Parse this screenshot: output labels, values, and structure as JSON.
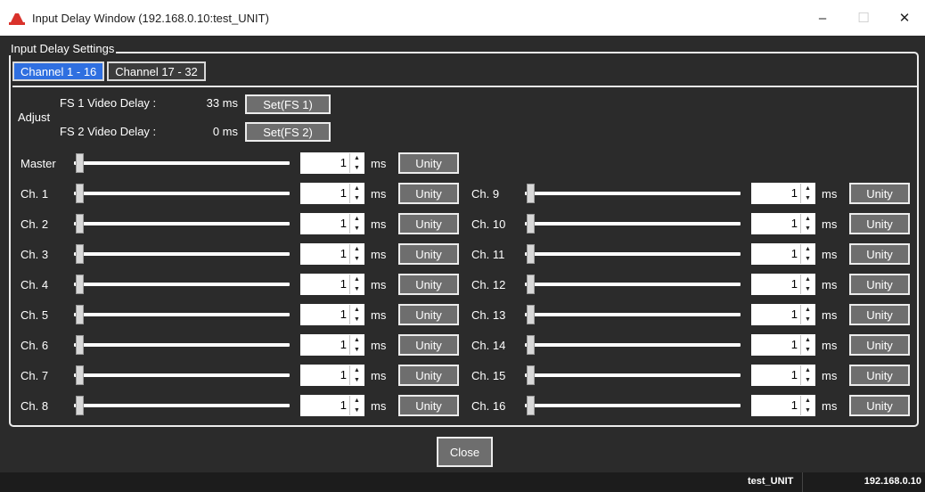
{
  "window": {
    "title": "Input Delay Window (192.168.0.10:test_UNIT)",
    "minimize": "–",
    "maximize": "☐",
    "close": "✕"
  },
  "group": {
    "title": "Input Delay Settings"
  },
  "tabs": [
    {
      "label": "Channel  1 - 16",
      "active": true
    },
    {
      "label": "Channel 17 - 32",
      "active": false
    }
  ],
  "adjust": {
    "label": "Adjust",
    "fs1": {
      "label": "FS 1 Video Delay :",
      "value": "33 ms",
      "button": "Set(FS 1)"
    },
    "fs2": {
      "label": "FS 2 Video Delay :",
      "value": "0 ms",
      "button": "Set(FS 2)"
    }
  },
  "master": {
    "label": "Master",
    "value": "1",
    "unit": "ms",
    "unity": "Unity",
    "slider_level": 0
  },
  "channels_left": [
    {
      "label": "Ch.  1",
      "value": "1",
      "unit": "ms",
      "unity": "Unity",
      "slider_level": 0
    },
    {
      "label": "Ch.  2",
      "value": "1",
      "unit": "ms",
      "unity": "Unity",
      "slider_level": 0
    },
    {
      "label": "Ch.  3",
      "value": "1",
      "unit": "ms",
      "unity": "Unity",
      "slider_level": 0
    },
    {
      "label": "Ch.  4",
      "value": "1",
      "unit": "ms",
      "unity": "Unity",
      "slider_level": 0
    },
    {
      "label": "Ch.  5",
      "value": "1",
      "unit": "ms",
      "unity": "Unity",
      "slider_level": 0
    },
    {
      "label": "Ch.  6",
      "value": "1",
      "unit": "ms",
      "unity": "Unity",
      "slider_level": 0
    },
    {
      "label": "Ch.  7",
      "value": "1",
      "unit": "ms",
      "unity": "Unity",
      "slider_level": 0
    },
    {
      "label": "Ch.  8",
      "value": "1",
      "unit": "ms",
      "unity": "Unity",
      "slider_level": 0
    }
  ],
  "channels_right": [
    {
      "label": "Ch.  9",
      "value": "1",
      "unit": "ms",
      "unity": "Unity",
      "slider_level": 0
    },
    {
      "label": "Ch. 10",
      "value": "1",
      "unit": "ms",
      "unity": "Unity",
      "slider_level": 0
    },
    {
      "label": "Ch. 11",
      "value": "1",
      "unit": "ms",
      "unity": "Unity",
      "slider_level": 0
    },
    {
      "label": "Ch. 12",
      "value": "1",
      "unit": "ms",
      "unity": "Unity",
      "slider_level": 0
    },
    {
      "label": "Ch. 13",
      "value": "1",
      "unit": "ms",
      "unity": "Unity",
      "slider_level": 0
    },
    {
      "label": "Ch. 14",
      "value": "1",
      "unit": "ms",
      "unity": "Unity",
      "slider_level": 0
    },
    {
      "label": "Ch. 15",
      "value": "1",
      "unit": "ms",
      "unity": "Unity",
      "slider_level": 0
    },
    {
      "label": "Ch. 16",
      "value": "1",
      "unit": "ms",
      "unity": "Unity",
      "slider_level": 0
    }
  ],
  "close_button": "Close",
  "status": {
    "unit": "test_UNIT",
    "ip": "192.168.0.10"
  },
  "colors": {
    "active_tab": "#2f6fe0",
    "background": "#2b2b2b",
    "button": "#6e6e6e",
    "app_icon": "#d9322b"
  }
}
